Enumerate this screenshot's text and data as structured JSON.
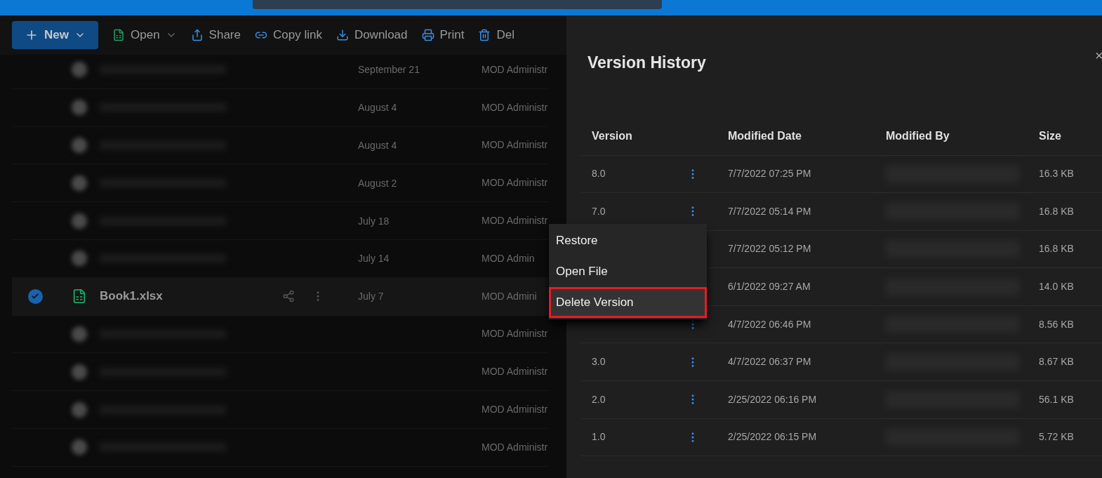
{
  "toolbar": {
    "items": [
      {
        "kind": "primary",
        "label": "New"
      },
      {
        "kind": "excel",
        "label": "Open"
      },
      {
        "kind": "share",
        "label": "Share"
      },
      {
        "kind": "link",
        "label": "Copy link"
      },
      {
        "kind": "download",
        "label": "Download"
      },
      {
        "kind": "print",
        "label": "Print"
      },
      {
        "kind": "delete",
        "label": "Del"
      }
    ]
  },
  "files": {
    "rows": [
      {
        "date": "September 21",
        "modified_by": "MOD Administr",
        "selected": false
      },
      {
        "date": "August 4",
        "modified_by": "MOD Administr",
        "selected": false
      },
      {
        "date": "August 4",
        "modified_by": "MOD Administr",
        "selected": false
      },
      {
        "date": "August 2",
        "modified_by": "MOD Administr",
        "selected": false
      },
      {
        "date": "July 18",
        "modified_by": "MOD Administr",
        "selected": false
      },
      {
        "date": "July 14",
        "modified_by": "MOD Admin",
        "selected": false
      },
      {
        "name": "Book1.xlsx",
        "date": "July 7",
        "modified_by": "MOD Admini",
        "selected": true
      },
      {
        "modified_by": "MOD Administr",
        "selected": false
      },
      {
        "modified_by": "MOD Administr",
        "selected": false
      },
      {
        "modified_by": "MOD Administr",
        "selected": false
      },
      {
        "modified_by": "MOD Administr",
        "selected": false
      }
    ]
  },
  "panel": {
    "title": "Version History",
    "close": "×",
    "columns": [
      "Version",
      "Modified Date",
      "Modified By",
      "Size"
    ],
    "rows": [
      {
        "version": "8.0",
        "date": "7/7/2022 07:25 PM",
        "size": "16.3 KB"
      },
      {
        "version": "7.0",
        "date": "7/7/2022 05:14 PM",
        "size": "16.8 KB"
      },
      {
        "date": "7/7/2022 05:12 PM",
        "size": "16.8 KB"
      },
      {
        "date": "6/1/2022 09:27 AM",
        "size": "14.0 KB"
      },
      {
        "date": "4/7/2022 06:46 PM",
        "size": "8.56 KB"
      },
      {
        "version": "3.0",
        "date": "4/7/2022 06:37 PM",
        "size": "8.67 KB"
      },
      {
        "version": "2.0",
        "date": "2/25/2022 06:16 PM",
        "size": "56.1 KB"
      },
      {
        "version": "1.0",
        "date": "2/25/2022 06:15 PM",
        "size": "5.72 KB"
      }
    ]
  },
  "context_menu": {
    "items": [
      {
        "label": "Restore",
        "selected": false
      },
      {
        "label": "Open File",
        "selected": false
      },
      {
        "label": "Delete Version",
        "selected": true
      }
    ]
  }
}
